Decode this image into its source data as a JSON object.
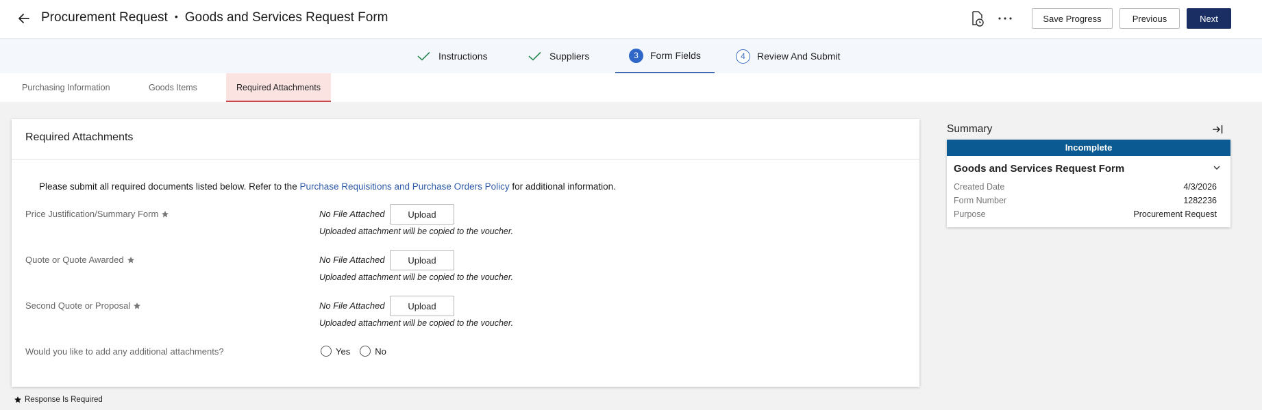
{
  "header": {
    "title": "Procurement Request",
    "separator": "•",
    "subtitle": "Goods and Services Request Form",
    "save_label": "Save Progress",
    "previous_label": "Previous",
    "next_label": "Next"
  },
  "stepper": {
    "steps": [
      {
        "label": "Instructions",
        "state": "complete"
      },
      {
        "label": "Suppliers",
        "state": "complete"
      },
      {
        "number": "3",
        "label": "Form Fields",
        "state": "active"
      },
      {
        "number": "4",
        "label": "Review And Submit",
        "state": "pending"
      }
    ]
  },
  "subtabs": [
    {
      "label": "Purchasing Information"
    },
    {
      "label": "Goods Items"
    },
    {
      "label": "Required Attachments",
      "active": true
    }
  ],
  "card": {
    "title": "Required Attachments",
    "intro_before": "Please submit all required documents listed below. Refer to the ",
    "intro_link": "Purchase Requisitions and Purchase Orders Policy",
    "intro_after": " for additional information.",
    "fields": [
      {
        "label": "Price Justification/Summary Form",
        "status": "No File Attached",
        "button": "Upload",
        "note": "Uploaded attachment will be copied to the voucher."
      },
      {
        "label": "Quote or Quote Awarded",
        "status": "No File Attached",
        "button": "Upload",
        "note": "Uploaded attachment will be copied to the voucher."
      },
      {
        "label": "Second Quote or Proposal",
        "status": "No File Attached",
        "button": "Upload",
        "note": "Uploaded attachment will be copied to the voucher."
      }
    ],
    "additional_question": "Would you like to add any additional attachments?",
    "yes_label": "Yes",
    "no_label": "No"
  },
  "footnote": "Response Is Required",
  "summary": {
    "title": "Summary",
    "status": "Incomplete",
    "form_title": "Goods and Services Request Form",
    "rows": [
      {
        "key": "Created Date",
        "value": "4/3/2026"
      },
      {
        "key": "Form Number",
        "value": "1282236"
      },
      {
        "key": "Purpose",
        "value": "Procurement Request"
      }
    ]
  },
  "colors": {
    "primary": "#1b2e63",
    "step_active": "#2f67c8",
    "status_bar": "#0b5a91",
    "link": "#2d5aa8",
    "check": "#2e8b57",
    "tab_active_bg": "#fbe3e2",
    "tab_active_border": "#c9474a"
  },
  "icons": {
    "back": "arrow-left-icon",
    "document": "document-clock-icon",
    "more": "more-horizontal-icon",
    "required": "star-icon",
    "collapse": "collapse-right-icon",
    "expand": "chevron-down-icon"
  }
}
